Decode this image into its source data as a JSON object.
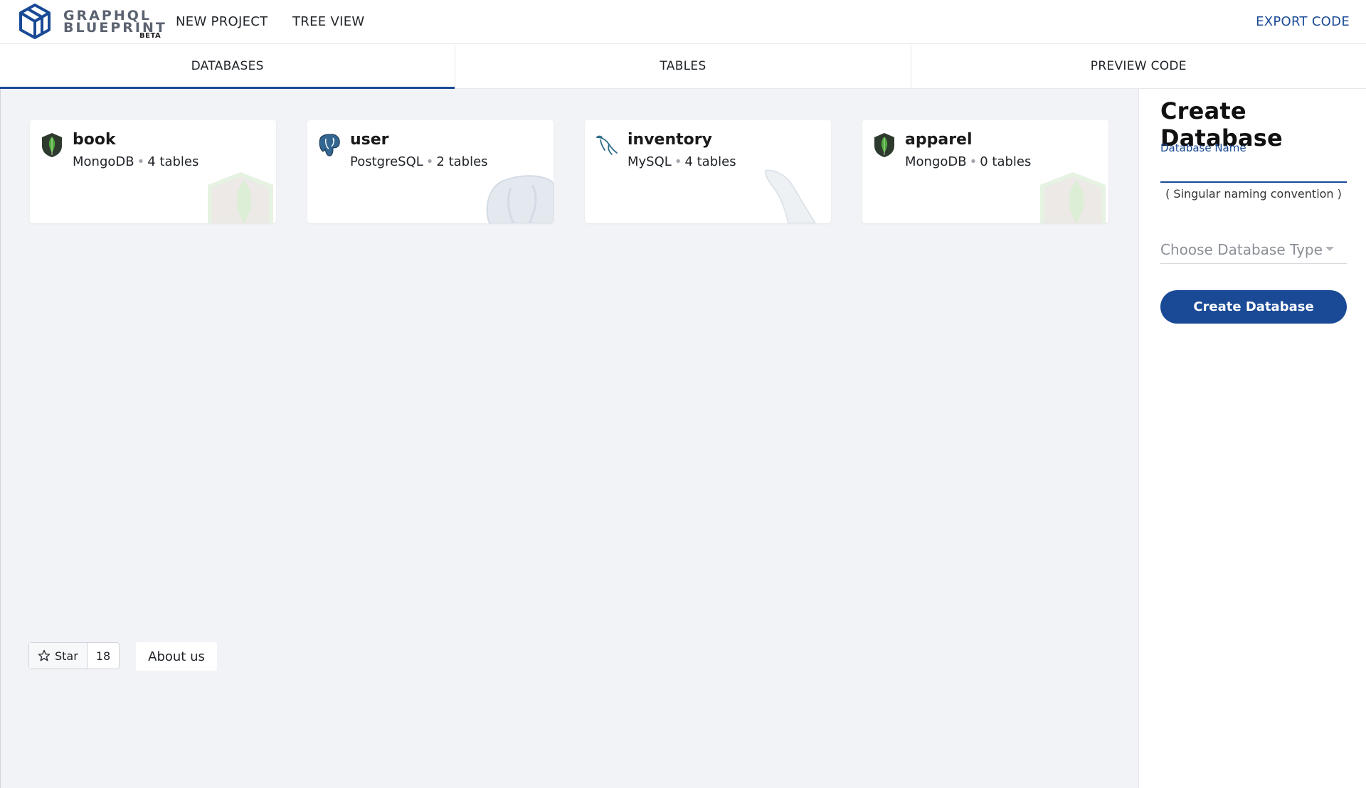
{
  "header": {
    "brand_line1": "GRAPHQL",
    "brand_line2": "BLUEPRINT",
    "brand_badge": "BETA",
    "nav": {
      "new_project": "NEW PROJECT",
      "tree_view": "TREE VIEW",
      "export_code": "EXPORT CODE"
    }
  },
  "tabs": [
    {
      "label": "DATABASES",
      "active": true
    },
    {
      "label": "TABLES",
      "active": false
    },
    {
      "label": "PREVIEW CODE",
      "active": false
    }
  ],
  "databases": [
    {
      "name": "book",
      "type": "MongoDB",
      "tables": "4 tables",
      "icon": "mongodb-icon"
    },
    {
      "name": "user",
      "type": "PostgreSQL",
      "tables": "2 tables",
      "icon": "postgresql-icon"
    },
    {
      "name": "inventory",
      "type": "MySQL",
      "tables": "4 tables",
      "icon": "mysql-icon"
    },
    {
      "name": "apparel",
      "type": "MongoDB",
      "tables": "0 tables",
      "icon": "mongodb-icon"
    }
  ],
  "footer": {
    "star_label": "Star",
    "star_count": "18",
    "about_label": "About us"
  },
  "create_panel": {
    "title": "Create Database",
    "name_label": "Database Name",
    "name_value": "",
    "name_hint": "( Singular naming convention )",
    "type_placeholder": "Choose Database Type",
    "submit_label": "Create Database"
  },
  "colors": {
    "accent": "#1a4a96",
    "canvas_bg": "#f1f3f6",
    "mongodb_green": "#3f9a3a",
    "postgres_blue": "#336791",
    "mysql_teal": "#2a6b86"
  }
}
